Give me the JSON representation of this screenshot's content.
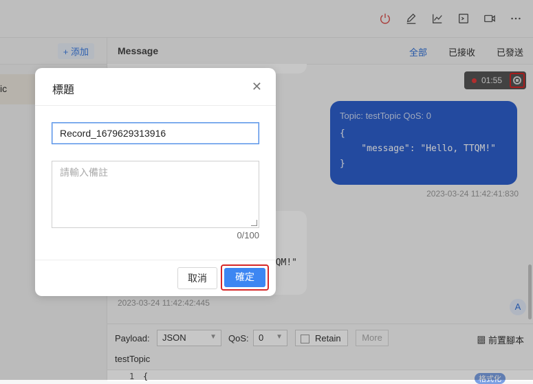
{
  "toolbar": {
    "icons": [
      "power-icon",
      "edit-icon",
      "chart-icon",
      "terminal-icon",
      "video-icon",
      "more-icon"
    ]
  },
  "left_panel": {
    "add_label": "+ 添加",
    "item_partial": "ic"
  },
  "message_panel": {
    "title": "Message",
    "filters": {
      "all": "全部",
      "received": "已接收",
      "sent": "已發送"
    },
    "recording_time": "01:55",
    "outgoing": {
      "meta": "Topic: testTopic   QoS: 0",
      "payload": "{\n    \"message\": \"Hello, TTQM!\"\n}",
      "timestamp": "2023-03-24 11:42:41:830"
    },
    "incoming": {
      "payload_partial": "QM!\"",
      "timestamp": "2023-03-24 11:42:42:445"
    },
    "avatar_letter": "A"
  },
  "compose": {
    "payload_label": "Payload:",
    "payload_value": "JSON",
    "qos_label": "QoS:",
    "qos_value": "0",
    "retain_label": "Retain",
    "more_label": "More",
    "pre_script_label": "前置腳本",
    "topic": "testTopic",
    "editor_line_number": "1",
    "editor_code": "{",
    "format_label": "格式化"
  },
  "dialog": {
    "title": "標題",
    "name_value": "Record_1679629313916",
    "remark_placeholder": "請輸入備註",
    "char_count": "0/100",
    "cancel_label": "取消",
    "confirm_label": "確定"
  }
}
